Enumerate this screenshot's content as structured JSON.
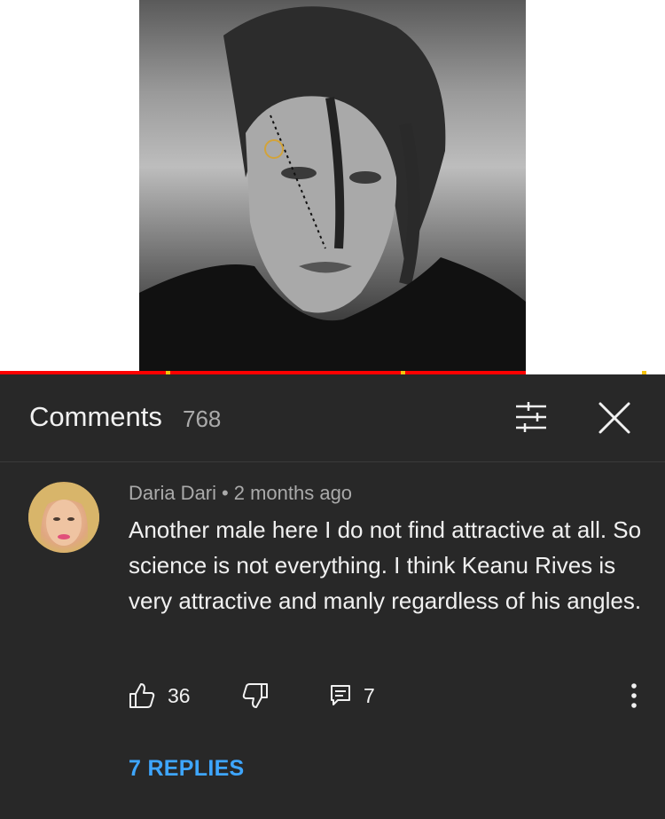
{
  "video": {
    "progress_percent": 79
  },
  "comments_panel": {
    "title": "Comments",
    "count": "768",
    "icons": {
      "sort": "sort-sliders-icon",
      "close": "close-icon"
    }
  },
  "comment": {
    "author": "Daria Dari",
    "separator": "•",
    "time": "2 months ago",
    "text": "Another male here I do not find attractive at all. So science is not everything. I think Keanu Rives is very attractive and manly regardless of his angles.",
    "likes": "36",
    "replies_count": "7",
    "replies_link": "7 REPLIES",
    "icons": {
      "like": "thumbs-up-icon",
      "dislike": "thumbs-down-icon",
      "reply": "reply-icon",
      "more": "more-vert-icon"
    }
  },
  "colors": {
    "panel_bg": "#282828",
    "link_blue": "#3ea6ff",
    "progress_red": "#ff0000",
    "ad_marker": "#f4c20d"
  }
}
